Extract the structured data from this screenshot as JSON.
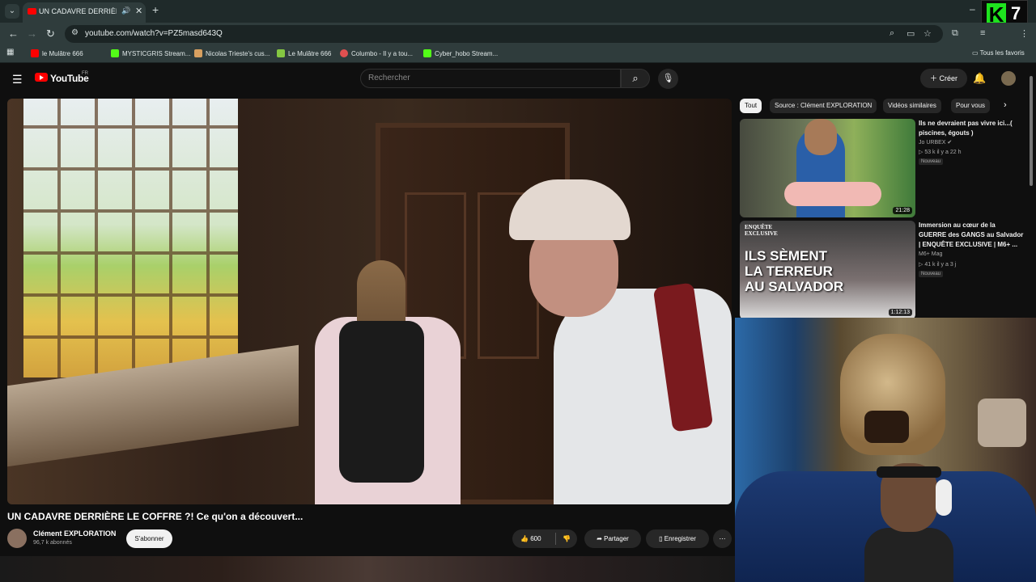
{
  "browser": {
    "tab_title": "UN CADAVRE DERRIÈRE LE COFFRE",
    "url": "youtube.com/watch?v=PZ5masd643Q",
    "bookmarks": [
      {
        "label": "le Mulâtre 666",
        "icon": "youtube-icon",
        "color": "#ff0000"
      },
      {
        "label": "MYSTICGRIS Stream...",
        "icon": "kick-icon",
        "color": "#53fc18"
      },
      {
        "label": "Nicolas Trieste's cus...",
        "icon": "deer-icon",
        "color": "#d8a060"
      },
      {
        "label": "Le Mulâtre 666",
        "icon": "rumble-icon",
        "color": "#85c742"
      },
      {
        "label": "Columbo - Il y a tou...",
        "icon": "site-icon",
        "color": "#e05050"
      },
      {
        "label": "Cyber_hobo Stream...",
        "icon": "kick-icon",
        "color": "#53fc18"
      }
    ],
    "all_bookmarks": "Tous les favoris"
  },
  "overlay_logo": {
    "letter": "K",
    "number": "7"
  },
  "youtube": {
    "logo": "YouTube",
    "region": "FR",
    "search_placeholder": "Rechercher",
    "create_label": "Créer"
  },
  "video": {
    "title": "UN CADAVRE DERRIÈRE LE COFFRE ?! Ce qu'on a découvert...",
    "channel": "Clément EXPLORATION",
    "subscribers": "96,7 k abonnés",
    "subscribe_label": "S'abonner",
    "likes": "600",
    "share_label": "Partager",
    "save_label": "Enregistrer",
    "more_icon": "more-icon"
  },
  "chips": [
    "Tout",
    "Source : Clément EXPLORATION",
    "Vidéos similaires",
    "Pour vous"
  ],
  "recommendations": [
    {
      "title": "Ils ne devraient pas vivre ici...( piscines, égouts )",
      "channel": "Jo URBEX",
      "verified": true,
      "meta": "53 k  il y a 22 h",
      "badge": "Nouveau",
      "duration": "21:28"
    },
    {
      "title": "Immersion au cœur de la GUERRE des GANGS au Salvador | ENQUÊTE EXCLUSIVE | M6+ ...",
      "channel": "M6+ Mag",
      "verified": false,
      "meta": "41 k  il y a 3 j",
      "badge": "Nouveau",
      "duration": "1:12:13",
      "thumb_badge": "ENQUÊTE\nEXCLUSIVE",
      "thumb_text": "ILS SÈMENT\nLA TERREUR\nAU SALVADOR"
    }
  ]
}
